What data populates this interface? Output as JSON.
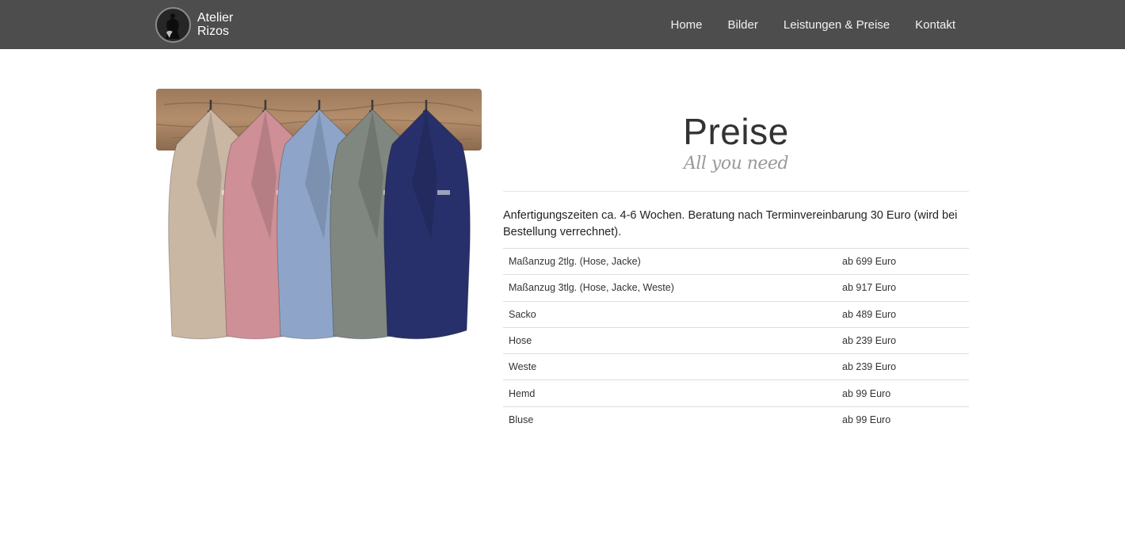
{
  "brand": {
    "line1": "Atelier",
    "line2": "Rizos",
    "logo_icon": "dress-form-icon"
  },
  "nav": {
    "items": [
      {
        "label": "Home"
      },
      {
        "label": "Bilder"
      },
      {
        "label": "Leistungen & Preise"
      },
      {
        "label": "Kontakt"
      }
    ]
  },
  "hero": {
    "jacket_colors": [
      "#c9b7a4",
      "#cf8f97",
      "#8ea5c9",
      "#7f8780",
      "#27306b"
    ]
  },
  "main": {
    "title": "Preise",
    "subtitle": "All you need",
    "intro": "Anfertigungszeiten ca. 4-6 Wochen. Beratung nach Terminvereinbarung 30 Euro (wird bei Bestellung verrechnet).",
    "prices": [
      {
        "item": "Maßanzug 2tlg. (Hose, Jacke)",
        "price": "ab 699 Euro"
      },
      {
        "item": "Maßanzug 3tlg. (Hose, Jacke, Weste)",
        "price": "ab 917 Euro"
      },
      {
        "item": "Sacko",
        "price": "ab 489 Euro"
      },
      {
        "item": "Hose",
        "price": "ab 239 Euro"
      },
      {
        "item": "Weste",
        "price": "ab 239 Euro"
      },
      {
        "item": "Hemd",
        "price": "ab 99 Euro"
      },
      {
        "item": "Bluse",
        "price": "ab 99 Euro"
      }
    ]
  }
}
